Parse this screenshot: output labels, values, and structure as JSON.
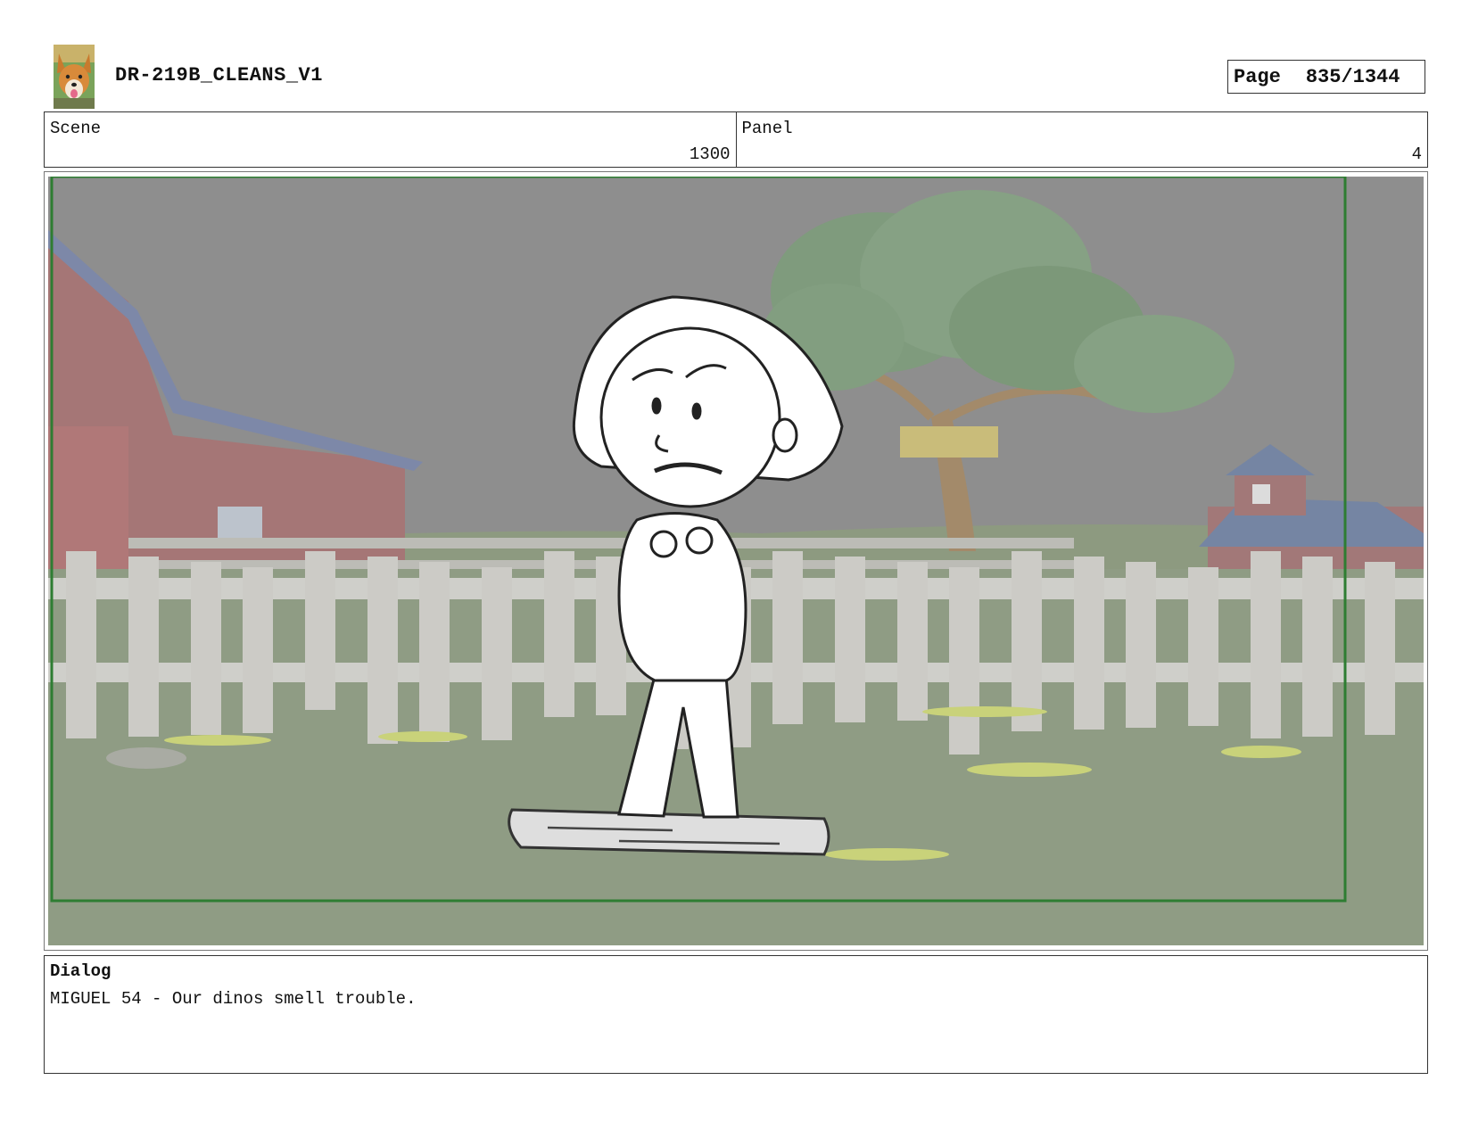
{
  "header": {
    "logo_icon": "corgi-dog-photo",
    "title": "DR-219B_CLEANS_V1",
    "page_label": "Page",
    "page_number": "835/1344"
  },
  "info": {
    "scene_label": "Scene",
    "scene_value": "1300",
    "panel_label": "Panel",
    "panel_value": "4"
  },
  "panel_image": {
    "frame_color": "#2e7d32",
    "sky_color": "#8e8e8e",
    "grass_color": "#8f9c84"
  },
  "dialog": {
    "label": "Dialog",
    "text": "MIGUEL 54 - Our dinos smell trouble."
  }
}
